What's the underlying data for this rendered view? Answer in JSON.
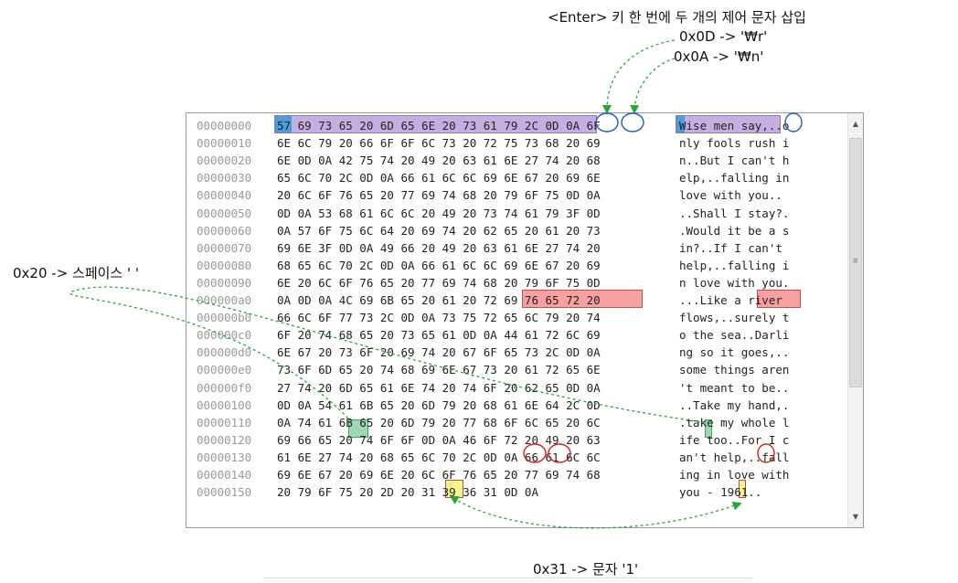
{
  "annotations": {
    "enter_title": "<Enter> 키 한 번에 두 개의 제어 문자 삽입",
    "cr_label": "0x0D -> '₩r'",
    "lf_label": "0x0A -> '₩n'",
    "space_label": "0x20 -> 스페이스 ' '",
    "one_label": "0x31 -> 문자 '1'"
  },
  "hex_rows": [
    {
      "offset": "00000000",
      "hex": "57 69 73 65 20 6D 65 6E  20 73 61 79 2C 0D 0A 6F",
      "ascii": "Wise men say,..o"
    },
    {
      "offset": "00000010",
      "hex": "6E 6C 79 20 66 6F 6F 6C  73 20 72 75 73 68 20 69",
      "ascii": "nly fools rush i"
    },
    {
      "offset": "00000020",
      "hex": "6E 0D 0A 42 75 74 20 49  20 63 61 6E 27 74 20 68",
      "ascii": "n..But I can't h"
    },
    {
      "offset": "00000030",
      "hex": "65 6C 70 2C 0D 0A 66 61  6C 6C 69 6E 67 20 69 6E",
      "ascii": "elp,..falling in"
    },
    {
      "offset": "00000040",
      "hex": "20 6C 6F 76 65 20 77 69  74 68 20 79 6F 75 0D 0A",
      "ascii": " love with you.."
    },
    {
      "offset": "00000050",
      "hex": "0D 0A 53 68 61 6C 6C 20  49 20 73 74 61 79 3F 0D",
      "ascii": "..Shall I stay?."
    },
    {
      "offset": "00000060",
      "hex": "0A 57 6F 75 6C 64 20 69  74 20 62 65 20 61 20 73",
      "ascii": ".Would it be a s"
    },
    {
      "offset": "00000070",
      "hex": "69 6E 3F 0D 0A 49 66 20  49 20 63 61 6E 27 74 20",
      "ascii": "in?..If I can't "
    },
    {
      "offset": "00000080",
      "hex": "68 65 6C 70 2C 0D 0A 66  61 6C 6C 69 6E 67 20 69",
      "ascii": "help,..falling i"
    },
    {
      "offset": "00000090",
      "hex": "6E 20 6C 6F 76 65 20 77  69 74 68 20 79 6F 75 0D",
      "ascii": "n love with you."
    },
    {
      "offset": "000000a0",
      "hex": "0A 0D 0A 4C 69 6B 65 20  61 20 72 69 76 65 72 20",
      "ascii": "...Like a river "
    },
    {
      "offset": "000000b0",
      "hex": "66 6C 6F 77 73 2C 0D 0A  73 75 72 65 6C 79 20 74",
      "ascii": "flows,..surely t"
    },
    {
      "offset": "000000c0",
      "hex": "6F 20 74 68 65 20 73 65  61 0D 0A 44 61 72 6C 69",
      "ascii": "o the sea..Darli"
    },
    {
      "offset": "000000d0",
      "hex": "6E 67 20 73 6F 20 69 74  20 67 6F 65 73 2C 0D 0A",
      "ascii": "ng so it goes,.."
    },
    {
      "offset": "000000e0",
      "hex": "73 6F 6D 65 20 74 68 69  6E 67 73 20 61 72 65 6E",
      "ascii": "some things aren"
    },
    {
      "offset": "000000f0",
      "hex": "27 74 20 6D 65 61 6E 74  20 74 6F 20 62 65 0D 0A",
      "ascii": "'t meant to be.."
    },
    {
      "offset": "00000100",
      "hex": "0D 0A 54 61 6B 65 20 6D  79 20 68 61 6E 64 2C 0D",
      "ascii": "..Take my hand,."
    },
    {
      "offset": "00000110",
      "hex": "0A 74 61 6B 65 20 6D 79  20 77 68 6F 6C 65 20 6C",
      "ascii": ".take my whole l"
    },
    {
      "offset": "00000120",
      "hex": "69 66 65 20 74 6F 6F 0D  0A 46 6F 72 20 49 20 63",
      "ascii": "ife too..For I c"
    },
    {
      "offset": "00000130",
      "hex": "61 6E 27 74 20 68 65 6C  70 2C 0D 0A 66 61 6C 6C",
      "ascii": "an't help,..fall"
    },
    {
      "offset": "00000140",
      "hex": "69 6E 67 20 69 6E 20 6C  6F 76 65 20 77 69 74 68",
      "ascii": "ing in love with"
    },
    {
      "offset": "00000150",
      "hex": "20 79 6F 75 20 2D 20 31  39 36 31 0D 0A",
      "ascii": " you - 1961.."
    }
  ],
  "colors": {
    "purple": "#c6afe0",
    "pink": "#f6a0a0",
    "green": "#9ed9b4",
    "yellow": "#f7f58c",
    "blue_sel": "#4a9fd8",
    "circle_blue": "#1b5fb8",
    "circle_red": "#d42020",
    "arrow_green": "#2aa43c"
  },
  "icons": {
    "scroll_up": "▲",
    "scroll_down": "▼",
    "grip": "≡"
  }
}
